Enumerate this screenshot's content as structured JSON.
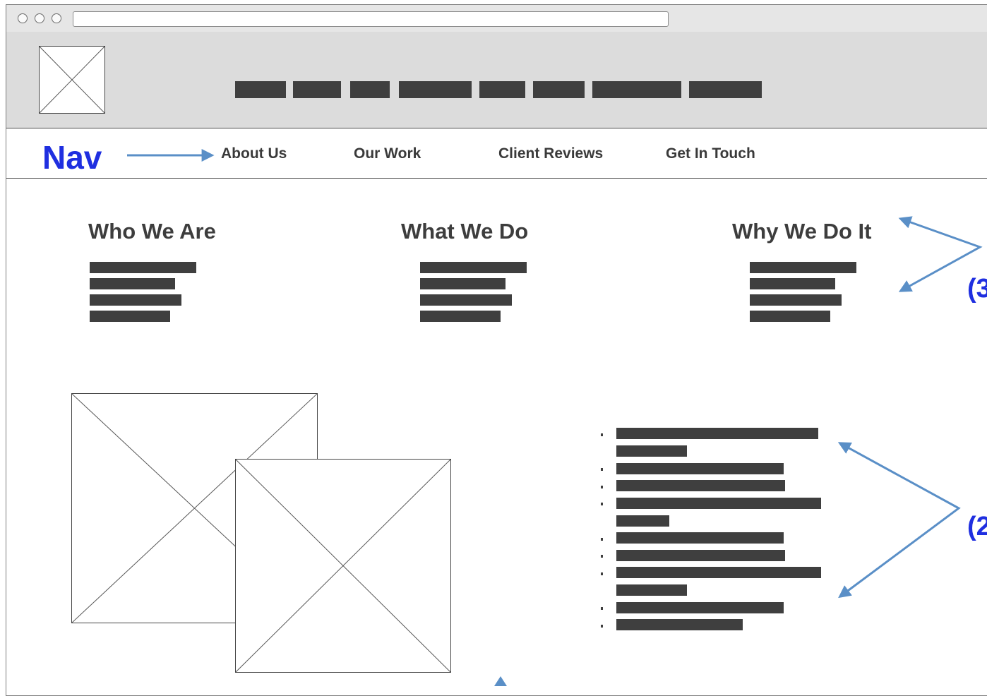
{
  "browser": {
    "url": ""
  },
  "nav": {
    "annotation": "Nav",
    "links": [
      "About Us",
      "Our Work",
      "Client Reviews",
      "Get In Touch"
    ]
  },
  "sections": {
    "titles": [
      "Who We Are",
      "What We Do",
      "Why We Do It"
    ]
  },
  "annotations": {
    "right_top": "(3",
    "right_mid": "(2"
  },
  "colors": {
    "annotation": "#1f2fe0",
    "arrow": "#5a8fc7",
    "bar": "#3f3f3f",
    "header_bg": "#dcdcdc"
  }
}
